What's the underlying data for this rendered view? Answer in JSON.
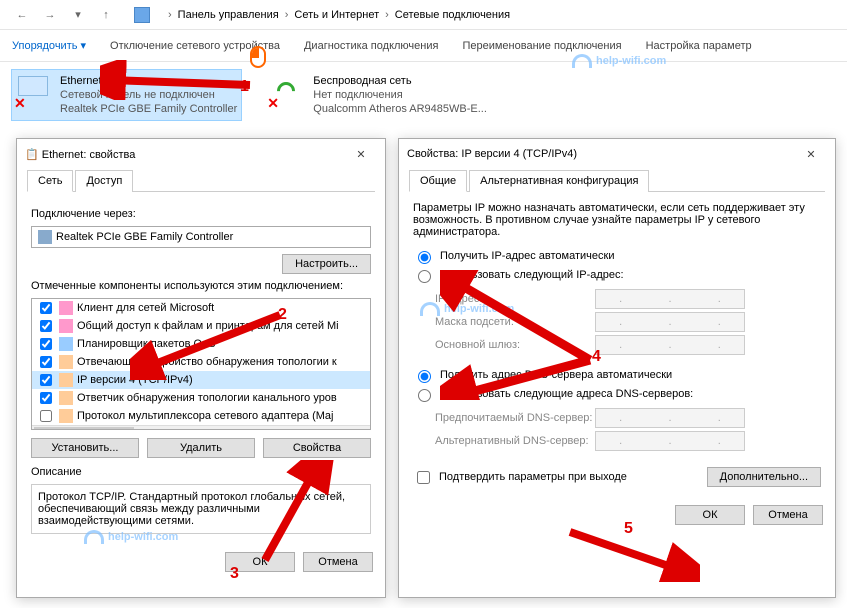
{
  "nav": {
    "root": "Панель управления",
    "l1": "Сеть и Интернет",
    "l2": "Сетевые подключения"
  },
  "cmd": {
    "organize": "Упорядочить",
    "disable": "Отключение сетевого устройства",
    "diagnose": "Диагностика подключения",
    "rename": "Переименование подключения",
    "settings": "Настройка параметр"
  },
  "conn1": {
    "name": "Ethernet",
    "status": "Сетевой кабель не подключен",
    "dev": "Realtek PCIe GBE Family Controller"
  },
  "conn2": {
    "name": "Беспроводная сеть",
    "status": "Нет подключения",
    "dev": "Qualcomm Atheros AR9485WB-E..."
  },
  "dlg1": {
    "title": "Ethernet: свойства",
    "tab_net": "Сеть",
    "tab_access": "Доступ",
    "connect_via": "Подключение через:",
    "adapter": "Realtek PCIe GBE Family Controller",
    "configure": "Настроить...",
    "components_label": "Отмеченные компоненты используются этим подключением:",
    "items": [
      "Клиент для сетей Microsoft",
      "Общий доступ к файлам и принтерам для сетей Mi",
      "Планировщик пакетов QoS",
      "Отвечающее устройство обнаружения топологии к",
      "IP версии 4 (TCP/IPv4)",
      "Ответчик обнаружения топологии канального уров",
      "Протокол мультиплексора сетевого адаптера (Maj"
    ],
    "install": "Установить...",
    "uninstall": "Удалить",
    "properties": "Свойства",
    "desc_lbl": "Описание",
    "desc": "Протокол TCP/IP. Стандартный протокол глобальных сетей, обеспечивающий связь между различными взаимодействующими сетями.",
    "ok": "ОК",
    "cancel": "Отмена"
  },
  "dlg2": {
    "title": "Свойства: IP версии 4 (TCP/IPv4)",
    "tab_general": "Общие",
    "tab_alt": "Альтернативная конфигурация",
    "intro": "Параметры IP можно назначать автоматически, если сеть поддерживает эту возможность. В противном случае узнайте параметры IP у сетевого администратора.",
    "ip_auto": "Получить IP-адрес автоматически",
    "ip_manual": "Использовать следующий IP-адрес:",
    "ip_addr": "IP-адрес:",
    "mask": "Маска подсети:",
    "gateway": "Основной шлюз:",
    "dns_auto": "Получить адрес DNS-сервера автоматически",
    "dns_manual": "Использовать следующие адреса DNS-серверов:",
    "dns1": "Предпочитаемый DNS-сервер:",
    "dns2": "Альтернативный DNS-сервер:",
    "validate": "Подтвердить параметры при выходе",
    "advanced": "Дополнительно...",
    "ok": "ОК",
    "cancel": "Отмена"
  },
  "wm": "help-wifi.com",
  "annot": {
    "n1": "1",
    "n2": "2",
    "n3": "3",
    "n4": "4",
    "n5": "5"
  }
}
